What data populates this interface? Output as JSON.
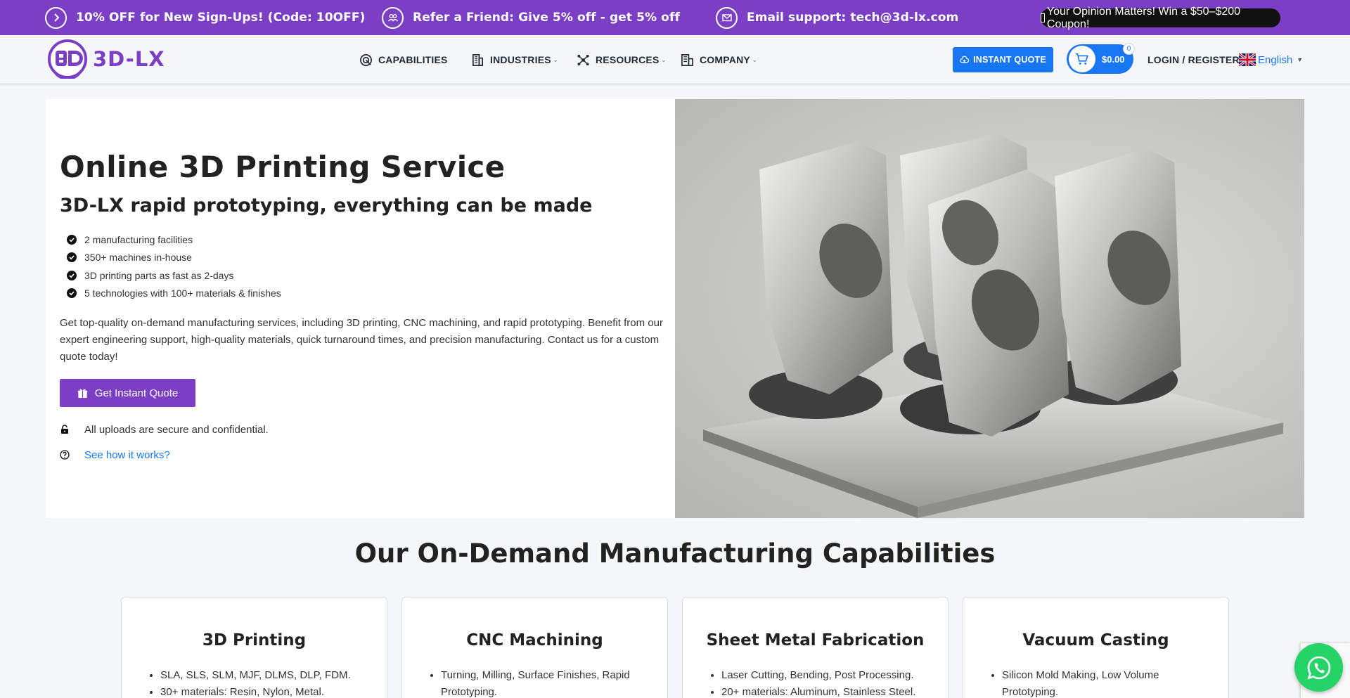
{
  "promo_bar": {
    "signup": "10% OFF for New Sign-Ups! (Code: 10OFF)",
    "referral": "Refer a Friend: Give 5% off - get 5% off",
    "support": "Email support: tech@3d-lx.com",
    "coupon": "Your Opinion Matters! Win a $50–$200 Coupon!"
  },
  "header": {
    "logo_text": "3D-LX",
    "nav": {
      "capabilities": "CAPABILITIES",
      "industries": "INDUSTRIES",
      "resources": "RESOURCES",
      "company": "COMPANY"
    },
    "instant_quote": "INSTANT QUOTE",
    "cart_total": "$0.00",
    "cart_count": "0",
    "login": "LOGIN / REGISTER",
    "language": "English"
  },
  "hero": {
    "title": "Online 3D Printing Service",
    "subtitle": "3D-LX rapid prototyping, everything can be made",
    "bullets": [
      "2 manufacturing facilities",
      "350+ machines in-house",
      "3D printing parts as fast as 2-days",
      "5 technologies with 100+ materials & finishes"
    ],
    "description": "Get top-quality on-demand manufacturing services, including 3D printing, CNC machining, and rapid prototyping. Benefit from our expert engineering support, high-quality materials, quick turnaround times, and precision manufacturing. Contact us for a custom quote today!",
    "cta": "Get Instant Quote",
    "secure_note": "All uploads are secure and confidential.",
    "how_link": "See how it works?"
  },
  "capabilities": {
    "title": "Our On-Demand Manufacturing Capabilities",
    "cards": [
      {
        "title": "3D Printing",
        "items": [
          "SLA, SLS, SLM, MJF, DLMS, DLP, FDM.",
          "30+ materials: Resin, Nylon, Metal."
        ]
      },
      {
        "title": "CNC Machining",
        "items": [
          "Turning, Milling, Surface Finishes, Rapid Prototyping."
        ]
      },
      {
        "title": "Sheet Metal Fabrication",
        "items": [
          "Laser Cutting, Bending, Post Processing.",
          "20+ materials: Aluminum, Stainless Steel."
        ]
      },
      {
        "title": "Vacuum Casting",
        "items": [
          "Silicon Mold Making, Low Volume Prototyping."
        ]
      }
    ]
  },
  "colors": {
    "brand_purple": "#7b3fc6",
    "action_blue": "#1976f3",
    "whatsapp_green": "#25d366"
  }
}
